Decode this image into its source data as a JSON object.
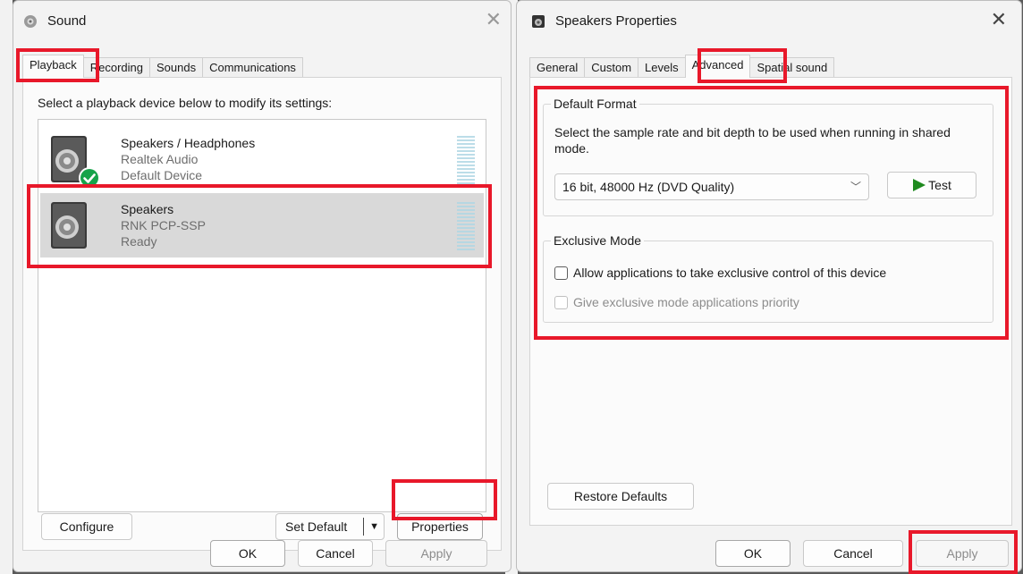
{
  "sound_window": {
    "title": "Sound",
    "tabs": [
      {
        "label": "Playback"
      },
      {
        "label": "Recording"
      },
      {
        "label": "Sounds"
      },
      {
        "label": "Communications"
      }
    ],
    "instruction": "Select a playback device below to modify its settings:",
    "devices": [
      {
        "name": "Speakers / Headphones",
        "driver": "Realtek Audio",
        "status": "Default Device"
      },
      {
        "name": "Speakers",
        "driver": "RNK PCP-SSP",
        "status": "Ready"
      }
    ],
    "buttons": {
      "configure": "Configure",
      "set_default": "Set Default",
      "properties": "Properties",
      "ok": "OK",
      "cancel": "Cancel",
      "apply": "Apply"
    }
  },
  "props_window": {
    "title": "Speakers Properties",
    "tabs": [
      {
        "label": "General"
      },
      {
        "label": "Custom"
      },
      {
        "label": "Levels"
      },
      {
        "label": "Advanced"
      },
      {
        "label": "Spatial sound"
      }
    ],
    "default_format": {
      "label": "Default Format",
      "description": "Select the sample rate and bit depth to be used when running in shared mode.",
      "selected": "16 bit, 48000 Hz (DVD Quality)",
      "test_label": "Test"
    },
    "exclusive_mode": {
      "label": "Exclusive Mode",
      "allow_label": "Allow applications to take exclusive control of this device",
      "priority_label": "Give exclusive mode applications priority"
    },
    "buttons": {
      "restore": "Restore Defaults",
      "ok": "OK",
      "cancel": "Cancel",
      "apply": "Apply"
    }
  },
  "colors": {
    "highlight": "#e8182a",
    "check_green": "#16a34a",
    "play_green": "#1f8a1f"
  }
}
